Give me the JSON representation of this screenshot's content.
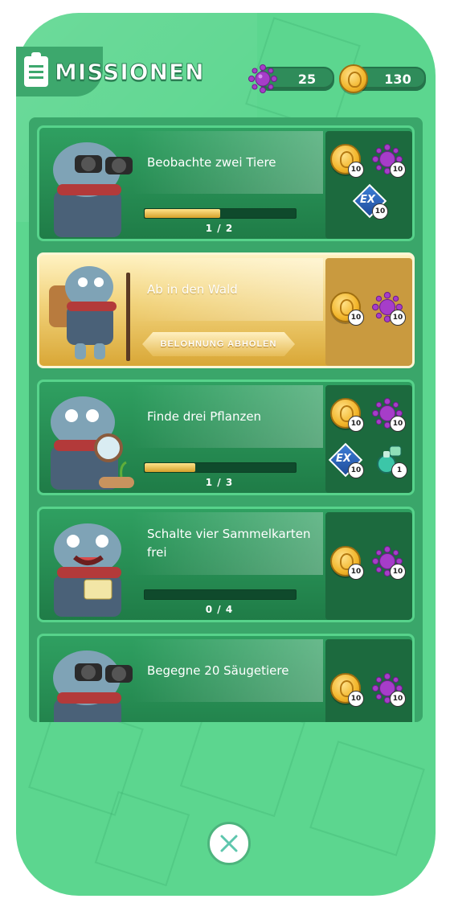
{
  "header": {
    "title": "MISSIONEN",
    "virus_count": "25",
    "coin_count": "130"
  },
  "missions": [
    {
      "title": "Beobachte zwei Tiere",
      "progress": 0.5,
      "progress_text": "1 / 2",
      "rewards": [
        {
          "type": "coin",
          "count": "10"
        },
        {
          "type": "virus",
          "count": "10"
        },
        {
          "type": "ex",
          "count": "10"
        }
      ]
    },
    {
      "title": "Ab in den Wald",
      "claim_label": "BELOHNUNG ABHOLEN",
      "rewards": [
        {
          "type": "coin",
          "count": "10"
        },
        {
          "type": "virus",
          "count": "10"
        }
      ]
    },
    {
      "title": "Finde drei Pflanzen",
      "progress": 0.333,
      "progress_text": "1 / 3",
      "rewards": [
        {
          "type": "coin",
          "count": "10"
        },
        {
          "type": "virus",
          "count": "10"
        },
        {
          "type": "ex",
          "count": "10"
        },
        {
          "type": "potion",
          "count": "1"
        }
      ]
    },
    {
      "title": "Schalte vier Sammelkarten frei",
      "progress": 0,
      "progress_text": "0 / 4",
      "rewards": [
        {
          "type": "coin",
          "count": "10"
        },
        {
          "type": "virus",
          "count": "10"
        }
      ]
    },
    {
      "title": "Begegne 20 Säugetiere",
      "rewards": [
        {
          "type": "coin",
          "count": "10"
        },
        {
          "type": "virus",
          "count": "10"
        }
      ]
    }
  ],
  "colors": {
    "panel": "#5cd68f",
    "card": "#2fa061",
    "gold": "#e6bc57",
    "virus": "#a63dc9"
  },
  "icons": {
    "header": "clipboard-icon",
    "close": "close-icon"
  }
}
